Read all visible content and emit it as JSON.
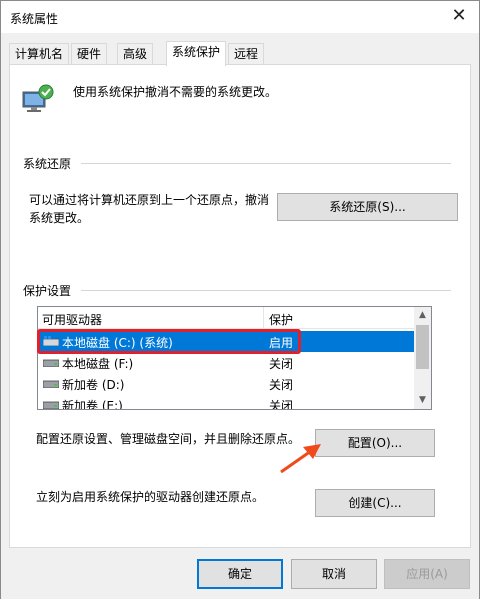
{
  "window": {
    "title": "系统属性",
    "close_glyph": "✕"
  },
  "tabs": [
    {
      "label": "计算机名"
    },
    {
      "label": "硬件"
    },
    {
      "label": "高级"
    },
    {
      "label": "系统保护",
      "active": true
    },
    {
      "label": "远程"
    }
  ],
  "intro": {
    "text": "使用系统保护撤消不需要的系统更改。",
    "icon": "computer-shield-icon"
  },
  "restore": {
    "group_title": "系统还原",
    "desc_line1": "可以通过将计算机还原到上一个还原点，撤消",
    "desc_line2": "系统更改。",
    "button_label": "系统还原(S)..."
  },
  "protection": {
    "group_title": "保护设置",
    "columns": {
      "drive": "可用驱动器",
      "status": "保护"
    },
    "drives": [
      {
        "name": "本地磁盘 (C:) (系统)",
        "status": "启用",
        "selected": true,
        "icon": "system-drive-icon"
      },
      {
        "name": "本地磁盘 (F:)",
        "status": "关闭",
        "icon": "drive-icon"
      },
      {
        "name": "新加卷 (D:)",
        "status": "关闭",
        "icon": "drive-icon"
      },
      {
        "name": "新加卷 (E:)",
        "status": "关闭",
        "icon": "drive-icon"
      }
    ],
    "config_desc": "配置还原设置、管理磁盘空间，并且删除还原点。",
    "config_button": "配置(O)...",
    "create_desc": "立刻为启用系统保护的驱动器创建还原点。",
    "create_button": "创建(C)..."
  },
  "footer": {
    "ok": "确定",
    "cancel": "取消",
    "apply": "应用(A)"
  },
  "colors": {
    "accent": "#0078d7",
    "highlight_annotation": "#e0202a",
    "arrow_annotation": "#f04a1c"
  }
}
